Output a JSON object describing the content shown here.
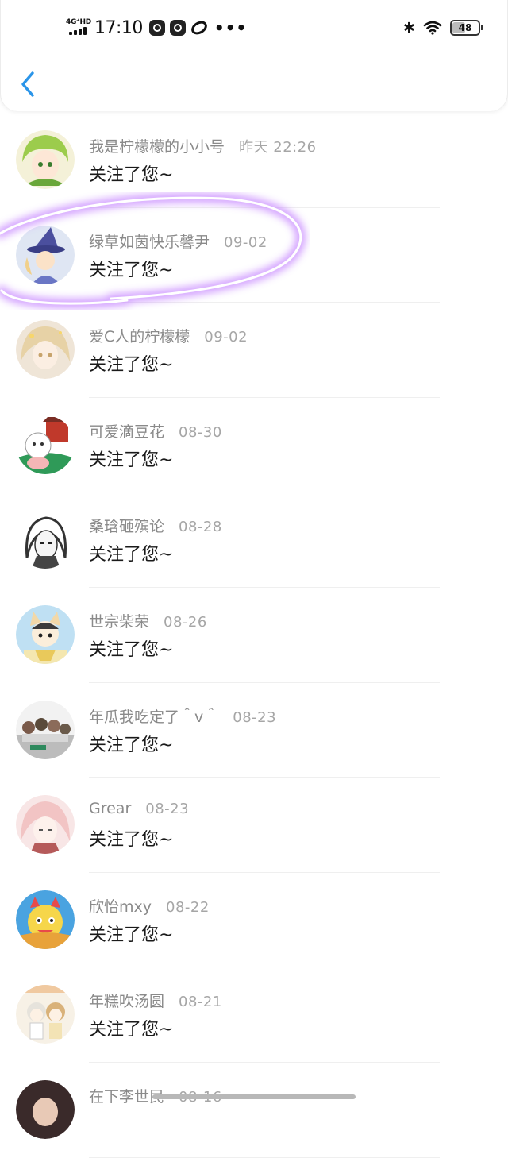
{
  "status_bar": {
    "network": "4G⁺HD",
    "time": "17:10",
    "battery": "48",
    "battery_level": 0.48,
    "icons": [
      "signal-icon",
      "video-app-icon",
      "video-app-icon",
      "link-app-icon",
      "more-dots-icon",
      "bluetooth-icon",
      "wifi-icon",
      "battery-icon"
    ]
  },
  "header": {
    "back_icon": "chevron-left-icon",
    "accent": "#2b95e9"
  },
  "colors": {
    "name": "#8a8a8a",
    "date": "#a6a6a6",
    "action": "#1a1a1a",
    "highlight": "#b57bff"
  },
  "notifications": [
    {
      "name": "我是柠檬檬的小小号",
      "date": "昨天 22:26",
      "action": "关注了您~",
      "avatar": "avatar-green-hair"
    },
    {
      "name": "绿草如茵快乐馨尹",
      "date": "09-02",
      "action": "关注了您~",
      "avatar": "avatar-witch-hat"
    },
    {
      "name": "爱C人的柠檬檬",
      "date": "09-02",
      "action": "关注了您~",
      "avatar": "avatar-blonde-girl"
    },
    {
      "name": "可爱滴豆花",
      "date": "08-30",
      "action": "关注了您~",
      "avatar": "avatar-cat-pavilion"
    },
    {
      "name": "桑琀砸殡论",
      "date": "08-28",
      "action": "关注了您~",
      "avatar": "avatar-sketch-portrait"
    },
    {
      "name": "世宗柴荣",
      "date": "08-26",
      "action": "关注了您~",
      "avatar": "avatar-cat-ears"
    },
    {
      "name": "年瓜我吃定了＾v＾",
      "date": "08-23",
      "action": "关注了您~",
      "avatar": "avatar-group"
    },
    {
      "name": "Grear",
      "date": "08-23",
      "action": "关注了您~",
      "avatar": "avatar-pink-hair"
    },
    {
      "name": "欣怡mxy",
      "date": "08-22",
      "action": "关注了您~",
      "avatar": "avatar-dragon"
    },
    {
      "name": "年糕吹汤圆",
      "date": "08-21",
      "action": "关注了您~",
      "avatar": "avatar-two-chibi"
    },
    {
      "name": "在下李世民",
      "date": "08-16",
      "action": "",
      "avatar": "avatar-dark"
    }
  ]
}
